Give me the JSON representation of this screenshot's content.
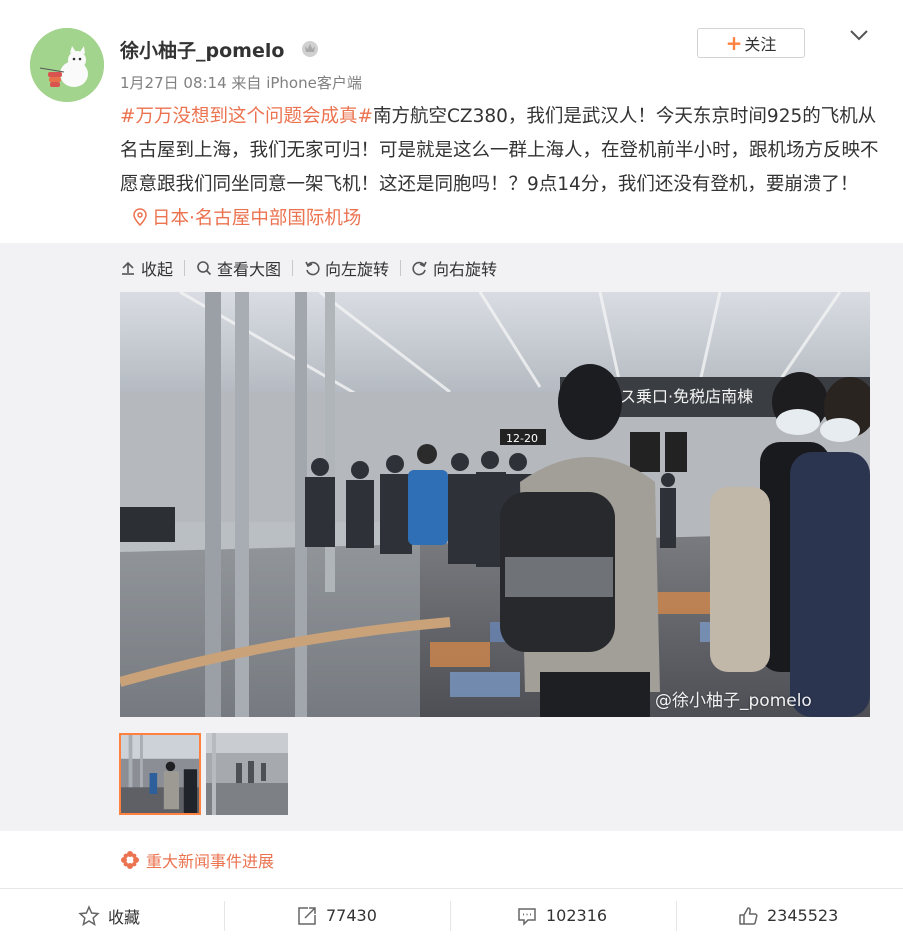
{
  "post": {
    "username": "徐小柚子_pomelo",
    "timestamp": "1月27日 08:14",
    "source": "来自 iPhone客户端",
    "follow_label": "关注",
    "content": {
      "topic": "#万万没想到这个问题会成真#",
      "text": "南方航空CZ380，我们是武汉人！今天东京时间925的飞机从名古屋到上海，我们无家可归！可是就是这么一群上海人，在登机前半小时，跟机场方反映不愿意跟我们同坐同意一架飞机！这还是同胞吗！？9点14分，我们还没有登机，要崩溃了！",
      "location": "日本·名古屋中部国际机场"
    }
  },
  "media": {
    "toolbar": {
      "collapse": "收起",
      "view_large": "查看大图",
      "rotate_left": "向左旋转",
      "rotate_right": "向右旋转"
    },
    "watermark": "@徐小柚子_pomelo",
    "photo_signs": {
      "gate": "12-20",
      "banner": "ス乗口·免税店南棟"
    }
  },
  "event_link": "重大新闻事件进展",
  "actions": {
    "favorite": "收藏",
    "repost": "77430",
    "comment": "102316",
    "like": "2345523"
  },
  "colors": {
    "accent": "#eb7350",
    "follow_plus": "#ff8140",
    "panel_bg": "#f2f2f5"
  }
}
